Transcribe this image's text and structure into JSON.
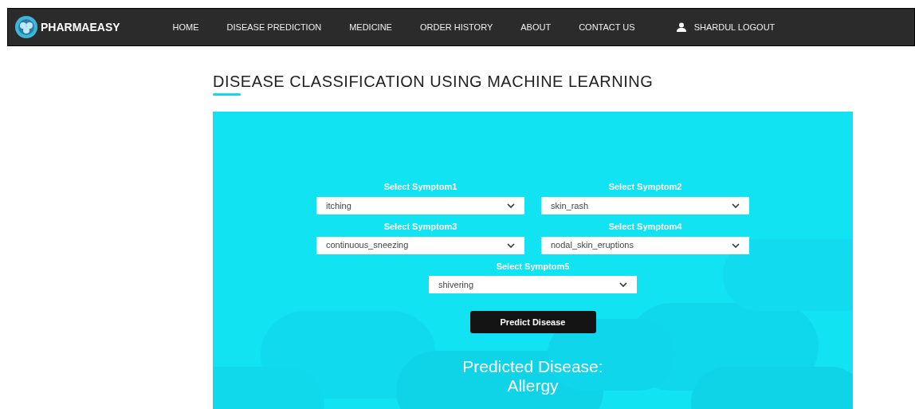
{
  "navbar": {
    "brand": "PHARMAEASY",
    "links": [
      "HOME",
      "DISEASE PREDICTION",
      "MEDICINE",
      "ORDER HISTORY",
      "ABOUT",
      "CONTACT US"
    ],
    "user_link": "SHARDUL LOGOUT"
  },
  "heading": "DISEASE CLASSIFICATION USING MACHINE LEARNING",
  "form": {
    "fields": [
      {
        "label": "Select Symptom1",
        "value": "itching"
      },
      {
        "label": "Select Symptom2",
        "value": "skin_rash"
      },
      {
        "label": "Select Symptom3",
        "value": "continuous_sneezing"
      },
      {
        "label": "Select Symptom4",
        "value": "nodal_skin_eruptions"
      },
      {
        "label": "Select Symptom5",
        "value": "shivering"
      }
    ],
    "button": "Predict Disease"
  },
  "result": {
    "label": "Predicted Disease:",
    "value": "Allergy"
  }
}
